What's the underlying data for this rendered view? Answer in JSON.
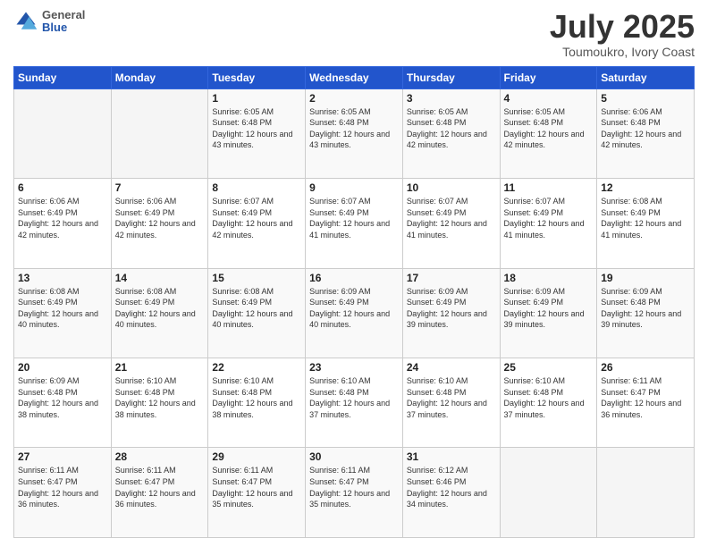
{
  "header": {
    "logo_general": "General",
    "logo_blue": "Blue",
    "month_title": "July 2025",
    "subtitle": "Toumoukro, Ivory Coast"
  },
  "calendar": {
    "days_of_week": [
      "Sunday",
      "Monday",
      "Tuesday",
      "Wednesday",
      "Thursday",
      "Friday",
      "Saturday"
    ],
    "weeks": [
      [
        {
          "day": "",
          "info": ""
        },
        {
          "day": "",
          "info": ""
        },
        {
          "day": "1",
          "info": "Sunrise: 6:05 AM\nSunset: 6:48 PM\nDaylight: 12 hours and 43 minutes."
        },
        {
          "day": "2",
          "info": "Sunrise: 6:05 AM\nSunset: 6:48 PM\nDaylight: 12 hours and 43 minutes."
        },
        {
          "day": "3",
          "info": "Sunrise: 6:05 AM\nSunset: 6:48 PM\nDaylight: 12 hours and 42 minutes."
        },
        {
          "day": "4",
          "info": "Sunrise: 6:05 AM\nSunset: 6:48 PM\nDaylight: 12 hours and 42 minutes."
        },
        {
          "day": "5",
          "info": "Sunrise: 6:06 AM\nSunset: 6:48 PM\nDaylight: 12 hours and 42 minutes."
        }
      ],
      [
        {
          "day": "6",
          "info": "Sunrise: 6:06 AM\nSunset: 6:49 PM\nDaylight: 12 hours and 42 minutes."
        },
        {
          "day": "7",
          "info": "Sunrise: 6:06 AM\nSunset: 6:49 PM\nDaylight: 12 hours and 42 minutes."
        },
        {
          "day": "8",
          "info": "Sunrise: 6:07 AM\nSunset: 6:49 PM\nDaylight: 12 hours and 42 minutes."
        },
        {
          "day": "9",
          "info": "Sunrise: 6:07 AM\nSunset: 6:49 PM\nDaylight: 12 hours and 41 minutes."
        },
        {
          "day": "10",
          "info": "Sunrise: 6:07 AM\nSunset: 6:49 PM\nDaylight: 12 hours and 41 minutes."
        },
        {
          "day": "11",
          "info": "Sunrise: 6:07 AM\nSunset: 6:49 PM\nDaylight: 12 hours and 41 minutes."
        },
        {
          "day": "12",
          "info": "Sunrise: 6:08 AM\nSunset: 6:49 PM\nDaylight: 12 hours and 41 minutes."
        }
      ],
      [
        {
          "day": "13",
          "info": "Sunrise: 6:08 AM\nSunset: 6:49 PM\nDaylight: 12 hours and 40 minutes."
        },
        {
          "day": "14",
          "info": "Sunrise: 6:08 AM\nSunset: 6:49 PM\nDaylight: 12 hours and 40 minutes."
        },
        {
          "day": "15",
          "info": "Sunrise: 6:08 AM\nSunset: 6:49 PM\nDaylight: 12 hours and 40 minutes."
        },
        {
          "day": "16",
          "info": "Sunrise: 6:09 AM\nSunset: 6:49 PM\nDaylight: 12 hours and 40 minutes."
        },
        {
          "day": "17",
          "info": "Sunrise: 6:09 AM\nSunset: 6:49 PM\nDaylight: 12 hours and 39 minutes."
        },
        {
          "day": "18",
          "info": "Sunrise: 6:09 AM\nSunset: 6:49 PM\nDaylight: 12 hours and 39 minutes."
        },
        {
          "day": "19",
          "info": "Sunrise: 6:09 AM\nSunset: 6:48 PM\nDaylight: 12 hours and 39 minutes."
        }
      ],
      [
        {
          "day": "20",
          "info": "Sunrise: 6:09 AM\nSunset: 6:48 PM\nDaylight: 12 hours and 38 minutes."
        },
        {
          "day": "21",
          "info": "Sunrise: 6:10 AM\nSunset: 6:48 PM\nDaylight: 12 hours and 38 minutes."
        },
        {
          "day": "22",
          "info": "Sunrise: 6:10 AM\nSunset: 6:48 PM\nDaylight: 12 hours and 38 minutes."
        },
        {
          "day": "23",
          "info": "Sunrise: 6:10 AM\nSunset: 6:48 PM\nDaylight: 12 hours and 37 minutes."
        },
        {
          "day": "24",
          "info": "Sunrise: 6:10 AM\nSunset: 6:48 PM\nDaylight: 12 hours and 37 minutes."
        },
        {
          "day": "25",
          "info": "Sunrise: 6:10 AM\nSunset: 6:48 PM\nDaylight: 12 hours and 37 minutes."
        },
        {
          "day": "26",
          "info": "Sunrise: 6:11 AM\nSunset: 6:47 PM\nDaylight: 12 hours and 36 minutes."
        }
      ],
      [
        {
          "day": "27",
          "info": "Sunrise: 6:11 AM\nSunset: 6:47 PM\nDaylight: 12 hours and 36 minutes."
        },
        {
          "day": "28",
          "info": "Sunrise: 6:11 AM\nSunset: 6:47 PM\nDaylight: 12 hours and 36 minutes."
        },
        {
          "day": "29",
          "info": "Sunrise: 6:11 AM\nSunset: 6:47 PM\nDaylight: 12 hours and 35 minutes."
        },
        {
          "day": "30",
          "info": "Sunrise: 6:11 AM\nSunset: 6:47 PM\nDaylight: 12 hours and 35 minutes."
        },
        {
          "day": "31",
          "info": "Sunrise: 6:12 AM\nSunset: 6:46 PM\nDaylight: 12 hours and 34 minutes."
        },
        {
          "day": "",
          "info": ""
        },
        {
          "day": "",
          "info": ""
        }
      ]
    ]
  }
}
